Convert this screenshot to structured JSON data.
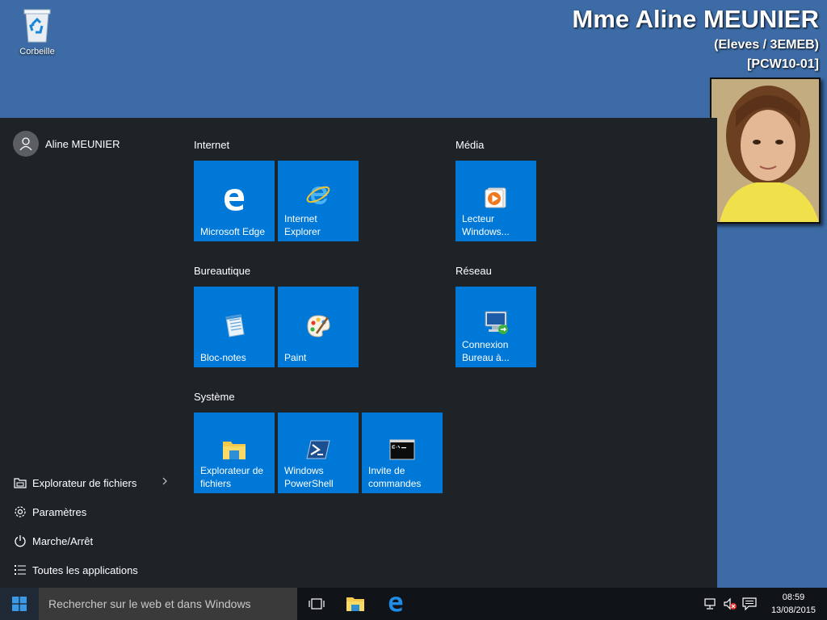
{
  "desktop": {
    "recycle_bin_label": "Corbeille"
  },
  "user_banner": {
    "name": "Mme Aline MEUNIER",
    "group": "(Eleves / 3EMEB)",
    "computer": "[PCW10-01]"
  },
  "start_menu": {
    "user_name": "Aline MEUNIER",
    "side_items": [
      {
        "label": "Explorateur de fichiers",
        "icon": "folder-icon"
      },
      {
        "label": "Paramètres",
        "icon": "gear-icon"
      },
      {
        "label": "Marche/Arrêt",
        "icon": "power-icon"
      },
      {
        "label": "Toutes les applications",
        "icon": "list-icon"
      }
    ],
    "groups": {
      "internet": "Internet",
      "media": "Média",
      "bureautique": "Bureautique",
      "reseau": "Réseau",
      "systeme": "Système"
    },
    "tiles": {
      "edge": "Microsoft Edge",
      "ie": "Internet\nExplorer",
      "wmp": "Lecteur\nWindows...",
      "notepad": "Bloc-notes",
      "paint": "Paint",
      "rdp": "Connexion\nBureau à...",
      "explorer": "Explorateur de\nfichiers",
      "powershell": "Windows\nPowerShell",
      "cmd": "Invite de\ncommandes"
    }
  },
  "taskbar": {
    "search_placeholder": "Rechercher sur le web et dans Windows",
    "time": "08:59",
    "date": "13/08/2015"
  },
  "colors": {
    "desktop": "#3c6ba5",
    "start_menu": "#1e2328",
    "tile": "#0078d7",
    "taskbar": "#101418"
  }
}
